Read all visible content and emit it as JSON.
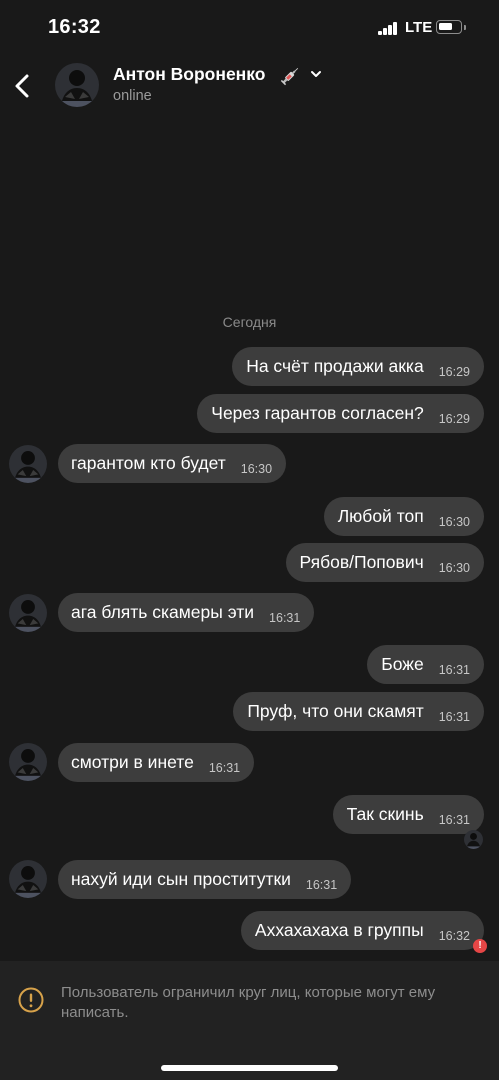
{
  "status_bar": {
    "time": "16:32",
    "network": "LTE",
    "battery_level": 0.7
  },
  "header": {
    "contact_name": "Антон Вороненко",
    "contact_status": "online",
    "name_icon": "syringe-icon"
  },
  "chat": {
    "date_separator": "Сегодня",
    "messages": [
      {
        "direction": "out",
        "text": "На счёт продажи акка",
        "time": "16:29"
      },
      {
        "direction": "out",
        "text": "Через гарантов согласен?",
        "time": "16:29"
      },
      {
        "direction": "in",
        "text": "гарантом кто будет",
        "time": "16:30"
      },
      {
        "direction": "out",
        "text": "Любой топ",
        "time": "16:30"
      },
      {
        "direction": "out",
        "text": "Рябов/Попович",
        "time": "16:30"
      },
      {
        "direction": "in",
        "text": "ага блять скамеры эти",
        "time": "16:31"
      },
      {
        "direction": "out",
        "text": "Боже",
        "time": "16:31"
      },
      {
        "direction": "out",
        "text": "Пруф, что они скамят",
        "time": "16:31"
      },
      {
        "direction": "in",
        "text": "смотри в инете",
        "time": "16:31"
      },
      {
        "direction": "out",
        "text": "Так скинь",
        "time": "16:31"
      },
      {
        "direction": "in",
        "text": "нахуй иди сын проститутки",
        "time": "16:31"
      },
      {
        "direction": "out",
        "text": "Аххахахаха в группы",
        "time": "16:32",
        "status": "error"
      }
    ]
  },
  "restriction_banner": {
    "text": "Пользователь ограничил круг лиц, которые могут ему написать.",
    "icon": "warning-icon",
    "accent_color": "#d7a24a"
  }
}
